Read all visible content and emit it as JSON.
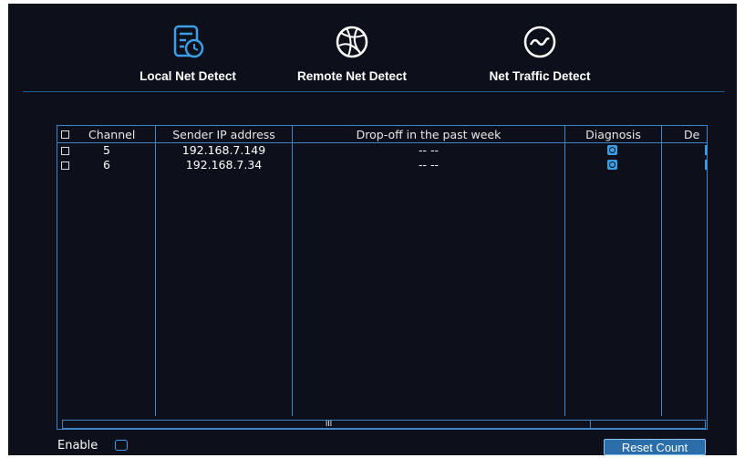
{
  "tabs": [
    {
      "label": "Local Net Detect",
      "icon": "local-net-detect-icon"
    },
    {
      "label": "Remote Net Detect",
      "icon": "remote-net-globe-icon"
    },
    {
      "label": "Net Traffic Detect",
      "icon": "net-traffic-wave-icon"
    }
  ],
  "table": {
    "headers": {
      "channel": "Channel",
      "sender_ip": "Sender IP address",
      "dropoff": "Drop-off in the past week",
      "diagnosis": "Diagnosis",
      "de": "De"
    },
    "rows": [
      {
        "channel": "5",
        "sender_ip": "192.168.7.149",
        "dropoff": "-- --"
      },
      {
        "channel": "6",
        "sender_ip": "192.168.7.34",
        "dropoff": "-- --"
      }
    ]
  },
  "scrollbar": {
    "grip": "III"
  },
  "footer": {
    "enable_label": "Enable",
    "reset_label": "Reset Count"
  },
  "colors": {
    "background": "#0d0f1a",
    "accent": "#3b9fe6",
    "border": "#3f86c8"
  }
}
